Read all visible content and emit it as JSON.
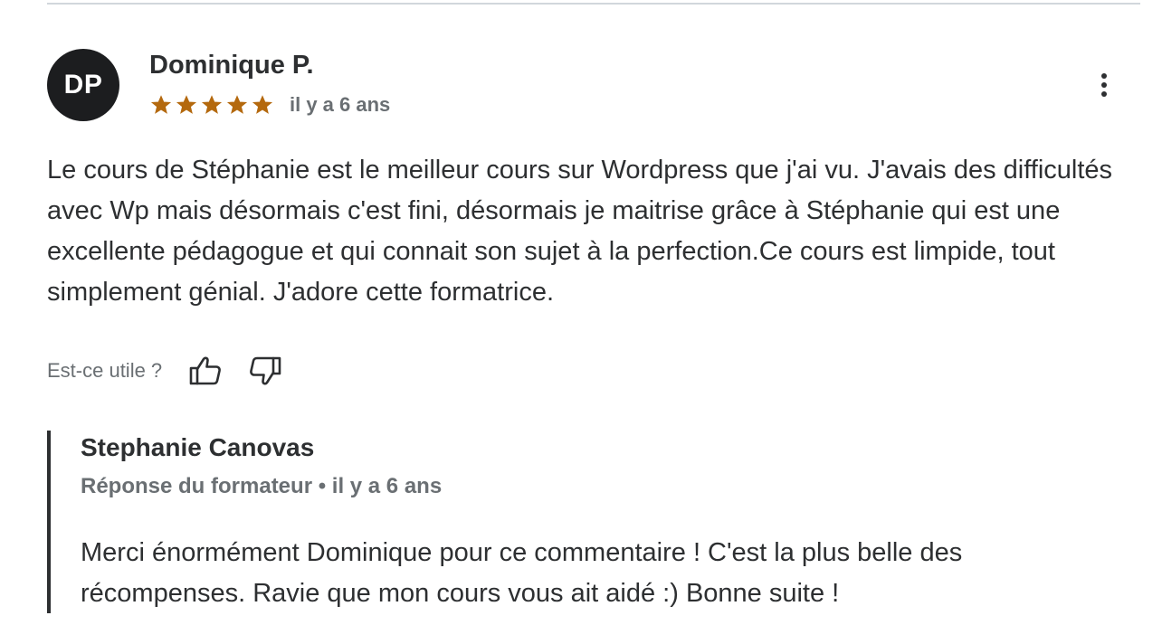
{
  "review": {
    "avatar_initials": "DP",
    "reviewer_name": "Dominique P.",
    "rating": 5,
    "rating_max": 5,
    "star_color": "#b4690e",
    "date": "il y a 6 ans",
    "more_icon": "more-vertical-icon",
    "text": "Le cours de Stéphanie est le meilleur cours sur Wordpress que j'ai vu. J'avais des difficultés avec Wp mais désormais c'est fini, désormais je maitrise grâce à Stéphanie qui est une excellente pédagogue et qui connait son sujet à la perfection.Ce cours est limpide, tout simplement génial. J'adore cette formatrice."
  },
  "helpful": {
    "label": "Est-ce utile ?",
    "thumbs_up_icon": "thumbs-up-icon",
    "thumbs_down_icon": "thumbs-down-icon"
  },
  "reply": {
    "author": "Stephanie Canovas",
    "meta": "Réponse du formateur • il y a 6 ans",
    "text": "Merci énormément Dominique pour ce commentaire ! C'est la plus belle des récompenses. Ravie que mon cours vous ait aidé :) Bonne suite !"
  }
}
